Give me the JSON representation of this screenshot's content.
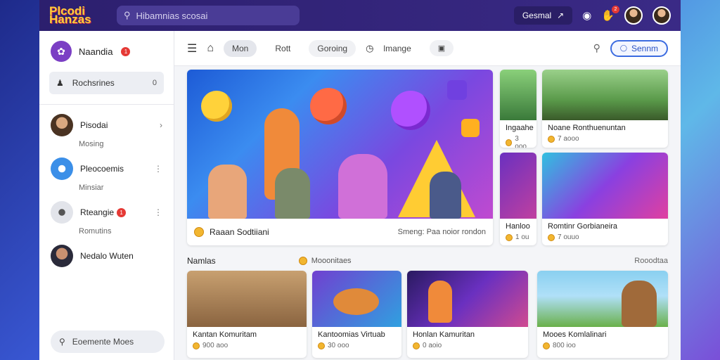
{
  "app": {
    "logo_text": "Plcodi Hanzas",
    "search_placeholder": "Hibamnias scosai"
  },
  "topbar": {
    "channel_label": "Gesmal",
    "notification_count": "2"
  },
  "sidebar": {
    "profile_name": "Naandia",
    "profile_badge": "1",
    "recent_label": "Rochsrines",
    "recent_count": "0",
    "friends": [
      {
        "name": "Pisodai",
        "sub": "Mosing",
        "avatar_color": "#caa27a"
      },
      {
        "name": "Pleocoemis",
        "sub": "Minsiar",
        "avatar_color": "#3b8fe8"
      },
      {
        "name": "Rteangie",
        "sub": "Romutins",
        "avatar_color": "#d8dbe2",
        "badge": "1"
      },
      {
        "name": "Nedalo Wuten",
        "sub": "",
        "avatar_color": "#b98a66"
      }
    ],
    "bottom_label": "Eoemente Moes"
  },
  "tabs": {
    "items": [
      "Mon",
      "Rott",
      "Goroing",
      "lmange"
    ],
    "action_label": "Sennm"
  },
  "hero": {
    "title": "Raaan Sodtiiani",
    "meta": "Smeng: Paa noior rondon"
  },
  "side_cards": [
    {
      "title": "Ingaahe",
      "meta": "3 ooo"
    },
    {
      "title": "Noane Ronthuenuntan",
      "meta": "7 aooo"
    },
    {
      "title": "Hanloo",
      "meta": "1 ou"
    },
    {
      "title": "Romtinr Gorbianeira",
      "meta": "7 ouuo"
    }
  ],
  "section": {
    "title": "Namlas",
    "mid_label": "Mooonitaes",
    "right_label": "Rooodtaa"
  },
  "bottom_cards": [
    {
      "title": "Kantan Komuritam",
      "meta": "900 aoo"
    },
    {
      "title": "Kantoomias Virtuab",
      "meta": "30 ooo"
    },
    {
      "title": "Honlan Kamuritan",
      "meta": "0 aoio"
    },
    {
      "title": "Mooes Komlalinari",
      "meta": "800 ioo"
    }
  ]
}
